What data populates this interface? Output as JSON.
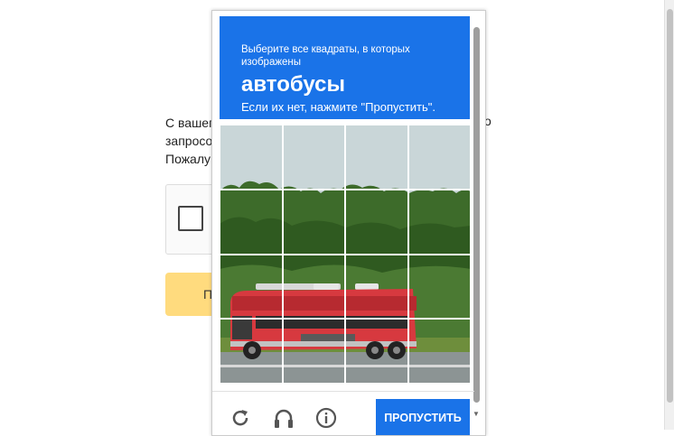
{
  "background": {
    "lines": [
      "С вашег",
      "запросо",
      "Пожалу"
    ],
    "right_fragment": "о",
    "button_fragment": "П"
  },
  "captcha": {
    "instruction": "Выберите все квадраты, в которых изображены",
    "target": "автобусы",
    "hint": "Если их нет, нажмите \"Пропустить\".",
    "skip_label": "ПРОПУСТИТЬ",
    "grid_size": 4,
    "footer_icons": [
      "reload-icon",
      "audio-headphones-icon",
      "info-icon"
    ]
  }
}
